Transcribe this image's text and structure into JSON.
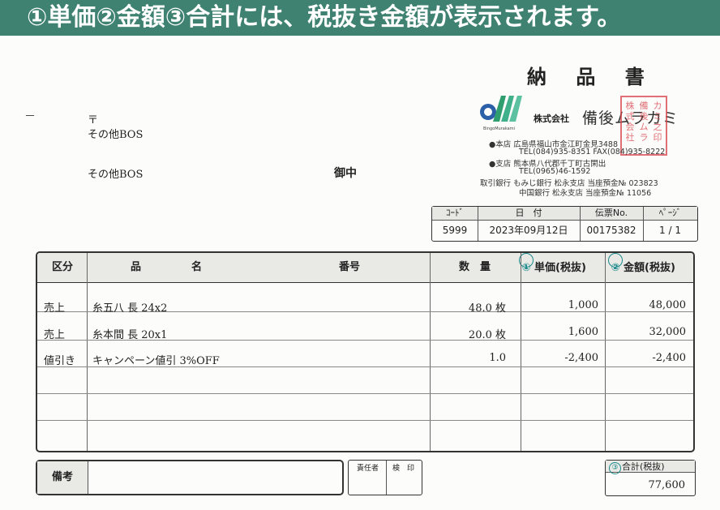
{
  "banner": "①単価②金額③合計には、税抜き金額が表示されます。",
  "doc": {
    "title": "納 品 書",
    "dash": "－",
    "postal_mark": "〒",
    "addr_line": "その他BOS",
    "customer_name": "その他BOS",
    "honorific": "御中"
  },
  "company": {
    "logo_sub": "BingoMurakami",
    "kk": "株式会社",
    "name": "備後ムラカミ",
    "seal_text": "株式会社備後ムラカミ之印",
    "hq": "●本店 広島県福山市金江町金見3488",
    "hq_tel": "TEL(084)935-8351  FAX(084)935-8222",
    "branch": "●支店 熊本県八代郡千丁町古閑出",
    "branch_tel": "TEL(0965)46-1592",
    "bank1": "取引銀行 もみじ銀行  松永支店  当座預金№  023823",
    "bank2": "中国銀行  松永支店  当座預金№  11056"
  },
  "slip": {
    "headers": [
      "ｺｰﾄﾞ",
      "日　付",
      "伝票No.",
      "ﾍﾟｰｼﾞ"
    ],
    "values": [
      "5999",
      "2023年09月12日",
      "00175382",
      "1 / 1"
    ]
  },
  "table": {
    "headers": {
      "kubun": "区分",
      "hin": "品",
      "mei": "名",
      "bango": "番号",
      "suryo": "数　量",
      "tanka_num": "①",
      "tanka": "単価(税抜)",
      "kingaku_num": "②",
      "kingaku": "金額(税抜)"
    },
    "rows": [
      {
        "kubun": "売上",
        "item": "糸五八 長 24x2",
        "qty": "48.0 枚",
        "price": "1,000",
        "amount": "48,000"
      },
      {
        "kubun": "売上",
        "item": "糸本間 長 20x1",
        "qty": "20.0 枚",
        "price": "1,600",
        "amount": "32,000"
      },
      {
        "kubun": "値引き",
        "item": "キャンペーン値引 3%OFF",
        "qty": "1.0",
        "price": "-2,400",
        "amount": "-2,400"
      }
    ]
  },
  "footer": {
    "remark_label": "備考",
    "resp1": "責任者",
    "resp2": "検　印",
    "total_num": "③",
    "total_label": "合計(税抜)",
    "total_value": "77,600"
  },
  "colors": {
    "banner_bg": "#3f8271",
    "seal": "#d8424a",
    "circle": "#1a8a8a"
  }
}
